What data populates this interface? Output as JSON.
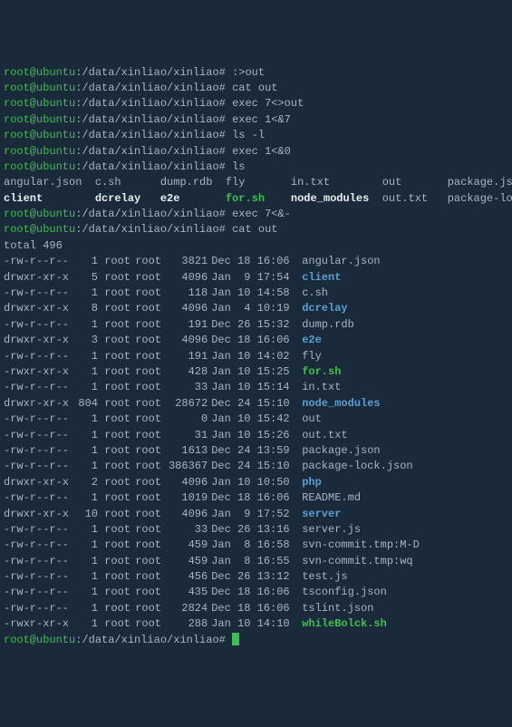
{
  "prompt": {
    "user": "root@ubuntu",
    "path": "/data/xinliao/xinliao",
    "sep": ":",
    "end": "#"
  },
  "cmds": [
    ":>out",
    "cat out",
    "exec 7<>out",
    "exec 1<&7",
    "ls -l",
    "exec 1<&0",
    "ls"
  ],
  "ls_cols": [
    [
      "angular.json",
      "plain"
    ],
    [
      "c.sh",
      "plain"
    ],
    [
      "dump.rdb",
      "plain"
    ],
    [
      "fly",
      "plain"
    ],
    [
      "in.txt",
      "plain"
    ],
    [
      "out",
      "plain"
    ],
    [
      "package.json",
      "plain"
    ],
    [
      "client",
      "bold"
    ],
    [
      "dcrelay",
      "bold"
    ],
    [
      "e2e",
      "bold"
    ],
    [
      "for.sh",
      "exe"
    ],
    [
      "node_modules",
      "bold"
    ],
    [
      "out.txt",
      "plain"
    ],
    [
      "package-lock.json",
      "plain"
    ]
  ],
  "post_cmds": [
    "exec 7<&-",
    "cat out"
  ],
  "total": "total 496",
  "rows": [
    {
      "perm": "-rw-r--r--",
      "l": "1",
      "o": "root",
      "g": "root",
      "s": "3821",
      "d": "Dec 18 16:06",
      "n": "angular.json",
      "t": "plain"
    },
    {
      "perm": "drwxr-xr-x",
      "l": "5",
      "o": "root",
      "g": "root",
      "s": "4096",
      "d": "Jan  9 17:54",
      "n": "client",
      "t": "dir"
    },
    {
      "perm": "-rw-r--r--",
      "l": "1",
      "o": "root",
      "g": "root",
      "s": "118",
      "d": "Jan 10 14:58",
      "n": "c.sh",
      "t": "plain"
    },
    {
      "perm": "drwxr-xr-x",
      "l": "8",
      "o": "root",
      "g": "root",
      "s": "4096",
      "d": "Jan  4 10:19",
      "n": "dcrelay",
      "t": "dir"
    },
    {
      "perm": "-rw-r--r--",
      "l": "1",
      "o": "root",
      "g": "root",
      "s": "191",
      "d": "Dec 26 15:32",
      "n": "dump.rdb",
      "t": "plain"
    },
    {
      "perm": "drwxr-xr-x",
      "l": "3",
      "o": "root",
      "g": "root",
      "s": "4096",
      "d": "Dec 18 16:06",
      "n": "e2e",
      "t": "dir"
    },
    {
      "perm": "-rw-r--r--",
      "l": "1",
      "o": "root",
      "g": "root",
      "s": "191",
      "d": "Jan 10 14:02",
      "n": "fly",
      "t": "plain"
    },
    {
      "perm": "-rwxr-xr-x",
      "l": "1",
      "o": "root",
      "g": "root",
      "s": "428",
      "d": "Jan 10 15:25",
      "n": "for.sh",
      "t": "exe"
    },
    {
      "perm": "-rw-r--r--",
      "l": "1",
      "o": "root",
      "g": "root",
      "s": "33",
      "d": "Jan 10 15:14",
      "n": "in.txt",
      "t": "plain"
    },
    {
      "perm": "drwxr-xr-x",
      "l": "804",
      "o": "root",
      "g": "root",
      "s": "28672",
      "d": "Dec 24 15:10",
      "n": "node_modules",
      "t": "dir"
    },
    {
      "perm": "-rw-r--r--",
      "l": "1",
      "o": "root",
      "g": "root",
      "s": "0",
      "d": "Jan 10 15:42",
      "n": "out",
      "t": "plain"
    },
    {
      "perm": "-rw-r--r--",
      "l": "1",
      "o": "root",
      "g": "root",
      "s": "31",
      "d": "Jan 10 15:26",
      "n": "out.txt",
      "t": "plain"
    },
    {
      "perm": "-rw-r--r--",
      "l": "1",
      "o": "root",
      "g": "root",
      "s": "1613",
      "d": "Dec 24 13:59",
      "n": "package.json",
      "t": "plain"
    },
    {
      "perm": "-rw-r--r--",
      "l": "1",
      "o": "root",
      "g": "root",
      "s": "386367",
      "d": "Dec 24 15:10",
      "n": "package-lock.json",
      "t": "plain"
    },
    {
      "perm": "drwxr-xr-x",
      "l": "2",
      "o": "root",
      "g": "root",
      "s": "4096",
      "d": "Jan 10 10:50",
      "n": "php",
      "t": "dir"
    },
    {
      "perm": "-rw-r--r--",
      "l": "1",
      "o": "root",
      "g": "root",
      "s": "1019",
      "d": "Dec 18 16:06",
      "n": "README.md",
      "t": "plain"
    },
    {
      "perm": "drwxr-xr-x",
      "l": "10",
      "o": "root",
      "g": "root",
      "s": "4096",
      "d": "Jan  9 17:52",
      "n": "server",
      "t": "dir"
    },
    {
      "perm": "-rw-r--r--",
      "l": "1",
      "o": "root",
      "g": "root",
      "s": "33",
      "d": "Dec 26 13:16",
      "n": "server.js",
      "t": "plain"
    },
    {
      "perm": "-rw-r--r--",
      "l": "1",
      "o": "root",
      "g": "root",
      "s": "459",
      "d": "Jan  8 16:58",
      "n": "svn-commit.tmp:M-D",
      "t": "plain"
    },
    {
      "perm": "-rw-r--r--",
      "l": "1",
      "o": "root",
      "g": "root",
      "s": "459",
      "d": "Jan  8 16:55",
      "n": "svn-commit.tmp:wq",
      "t": "plain"
    },
    {
      "perm": "-rw-r--r--",
      "l": "1",
      "o": "root",
      "g": "root",
      "s": "456",
      "d": "Dec 26 13:12",
      "n": "test.js",
      "t": "plain"
    },
    {
      "perm": "-rw-r--r--",
      "l": "1",
      "o": "root",
      "g": "root",
      "s": "435",
      "d": "Dec 18 16:06",
      "n": "tsconfig.json",
      "t": "plain"
    },
    {
      "perm": "-rw-r--r--",
      "l": "1",
      "o": "root",
      "g": "root",
      "s": "2824",
      "d": "Dec 18 16:06",
      "n": "tslint.json",
      "t": "plain"
    },
    {
      "perm": "-rwxr-xr-x",
      "l": "1",
      "o": "root",
      "g": "root",
      "s": "288",
      "d": "Jan 10 14:10",
      "n": "whileBolck.sh",
      "t": "exe"
    }
  ]
}
